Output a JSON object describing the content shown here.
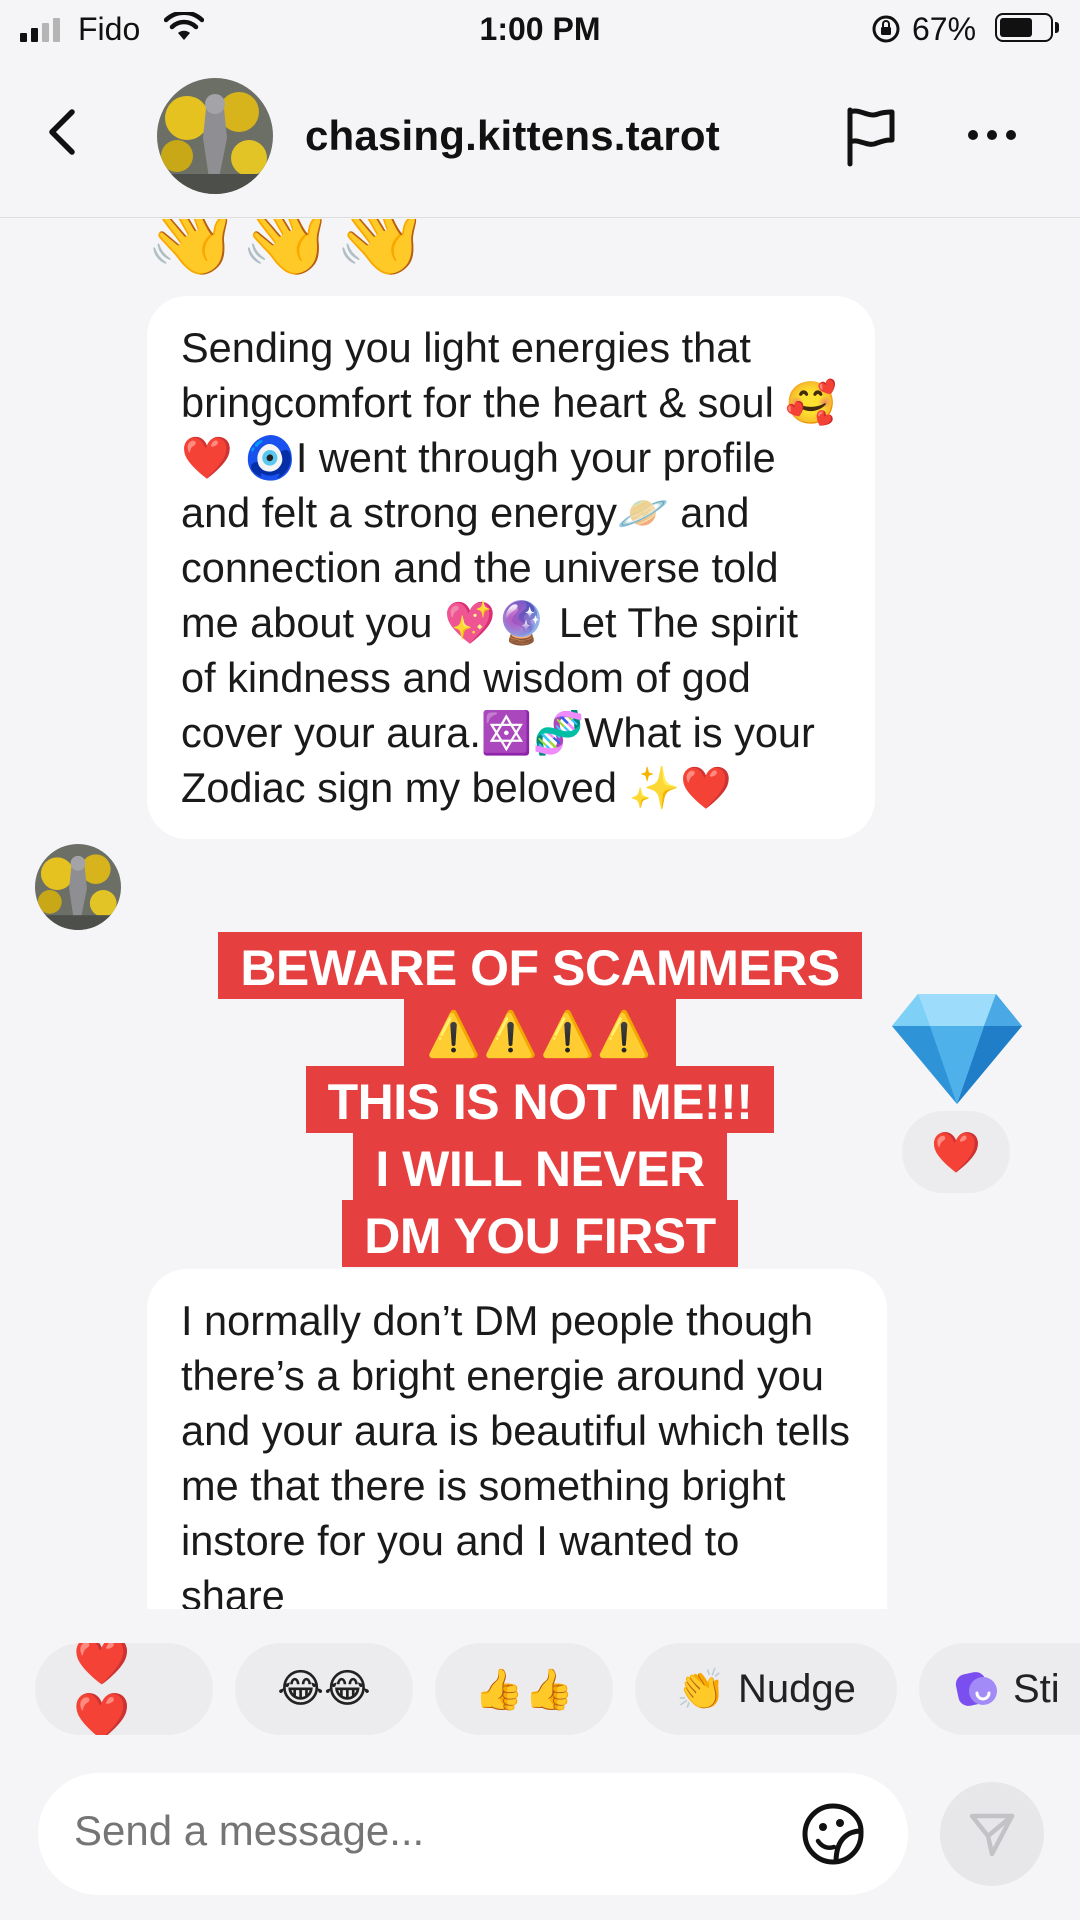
{
  "status_bar": {
    "carrier": "Fido",
    "time": "1:00 PM",
    "battery_percent": "67%",
    "battery_level": 0.67,
    "signal_bars": 2
  },
  "header": {
    "username": "chasing.kittens.tarot",
    "icons": [
      "back-chevron-icon",
      "flag-icon",
      "more-dots-icon"
    ]
  },
  "chat": {
    "wave_emojis": "👋👋👋",
    "message_1": "Sending you light energies that bringcomfort for the heart & soul 🥰❤️ 🧿I went through your profile and felt a strong energy🪐 and connection and the universe told me about you 💖🔮 Let The spirit of kindness and wisdom of god cover your aura.🔯🧬What is your Zodiac sign my beloved ✨❤️",
    "sent_sticker": "diamond-emoji",
    "sent_reaction": "❤️",
    "message_2": "I normally don’t DM people though there’s a bright energie around you and your aura is beautiful which tells me that there is something bright instore for you and I wanted to share"
  },
  "warning_overlay": {
    "line_1": "BEWARE OF SCAMMERS",
    "line_2": "⚠️⚠️⚠️⚠️",
    "line_3": "THIS IS NOT ME!!!",
    "line_4": "I WILL NEVER",
    "line_5": "DM YOU FIRST",
    "color": "#e5403f"
  },
  "quick_replies": [
    {
      "label": "❤️❤️"
    },
    {
      "label": "😂😂"
    },
    {
      "label": "👍👍"
    },
    {
      "label": "Nudge",
      "emoji": "👏"
    },
    {
      "label": "Sti",
      "icon": "sticker-icon"
    }
  ],
  "composer": {
    "placeholder": "Send a message..."
  }
}
